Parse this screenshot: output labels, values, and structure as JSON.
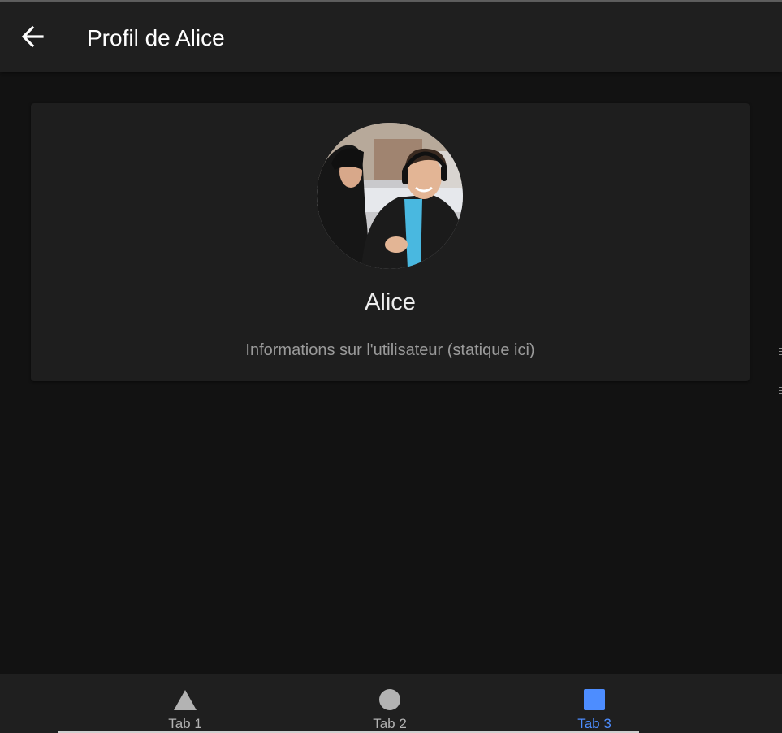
{
  "header": {
    "back_icon": "arrow-left-icon",
    "title": "Profil de Alice"
  },
  "profile": {
    "avatar_icon": "user-photo",
    "name": "Alice",
    "info": "Informations sur l'utilisateur (statique ici)"
  },
  "tabs": [
    {
      "label": "Tab 1",
      "icon": "triangle-icon",
      "active": false
    },
    {
      "label": "Tab 2",
      "icon": "circle-icon",
      "active": false
    },
    {
      "label": "Tab 3",
      "icon": "square-icon",
      "active": true
    }
  ],
  "colors": {
    "background": "#121212",
    "header": "#1f1f1f",
    "card": "#1e1e1e",
    "accent": "#4d8dff",
    "inactive_icon": "#b3b3b3"
  }
}
